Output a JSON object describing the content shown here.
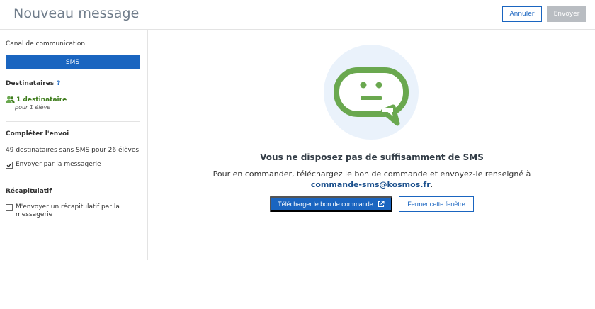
{
  "header": {
    "title": "Nouveau message",
    "cancel_label": "Annuler",
    "send_label": "Envoyer"
  },
  "sidebar": {
    "channel_label": "Canal de communication",
    "channel_value": "SMS",
    "recipients_title": "Destinataires",
    "recipients_help": "?",
    "recipients_count": "1 destinataire",
    "recipients_sub": "pour 1 élève",
    "complete_title": "Compléter l'envoi",
    "complete_info": "49 destinataires sans SMS pour 26 élèves",
    "complete_checkbox_label": "Envoyer par la messagerie",
    "complete_checkbox_checked": true,
    "summary_title": "Récapitulatif",
    "summary_checkbox_label": "M'envoyer un récapitulatif par la messagerie",
    "summary_checkbox_checked": false
  },
  "main": {
    "title": "Vous ne disposez pas de suffisamment de SMS",
    "body_text": "Pour en commander, téléchargez le bon de commande et envoyez-le renseigné à",
    "email": "commande-sms@kosmos.fr",
    "email_suffix": ".",
    "download_label": "Télécharger le bon de commande",
    "close_label": "Fermer cette fenêtre"
  },
  "colors": {
    "primary": "#1a65c0",
    "disabled": "#b9bdc2",
    "success_green": "#3f7d1d",
    "illustration_green": "#6aa84f",
    "illustration_bg": "#eaf2fb"
  },
  "icons": {
    "recipients": "users-icon",
    "download": "external-link-icon",
    "illustration": "chat-bubble-neutral-face-icon",
    "checkbox_checked": "check-icon"
  }
}
